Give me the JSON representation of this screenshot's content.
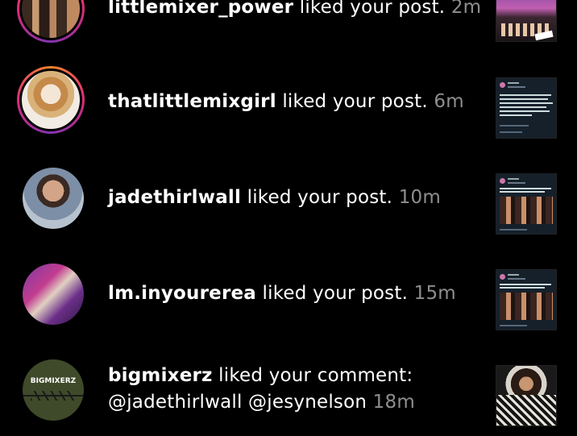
{
  "notifications": [
    {
      "username": "littlemixer_power",
      "action": "liked your post.",
      "time": "2m",
      "avatar": "story-ring",
      "thumbnail": "concert-photo"
    },
    {
      "username": "thatlittlemixgirl",
      "action": "liked your post.",
      "time": "6m",
      "avatar": "story-ring",
      "thumbnail": "tweet-screenshot-text"
    },
    {
      "username": "jadethirlwall",
      "action": "liked your post.",
      "time": "10m",
      "avatar": "plain",
      "thumbnail": "tweet-screenshot-photo"
    },
    {
      "username": "lm.inyourerea",
      "action": "liked your post.",
      "time": "15m",
      "avatar": "plain",
      "thumbnail": "tweet-screenshot-photo"
    },
    {
      "username": "bigmixerz",
      "action": "liked your comment:",
      "comment": "@jadethirlwall @jesynelson",
      "time": "18m",
      "avatar": "plain",
      "avatar_label": "BIGMIXERZ",
      "thumbnail": "portrait-photo"
    }
  ],
  "colors": {
    "background": "#000000",
    "text": "#ffffff",
    "timestamp": "#8e8e8e",
    "story_ring": "#dd2a7b"
  }
}
